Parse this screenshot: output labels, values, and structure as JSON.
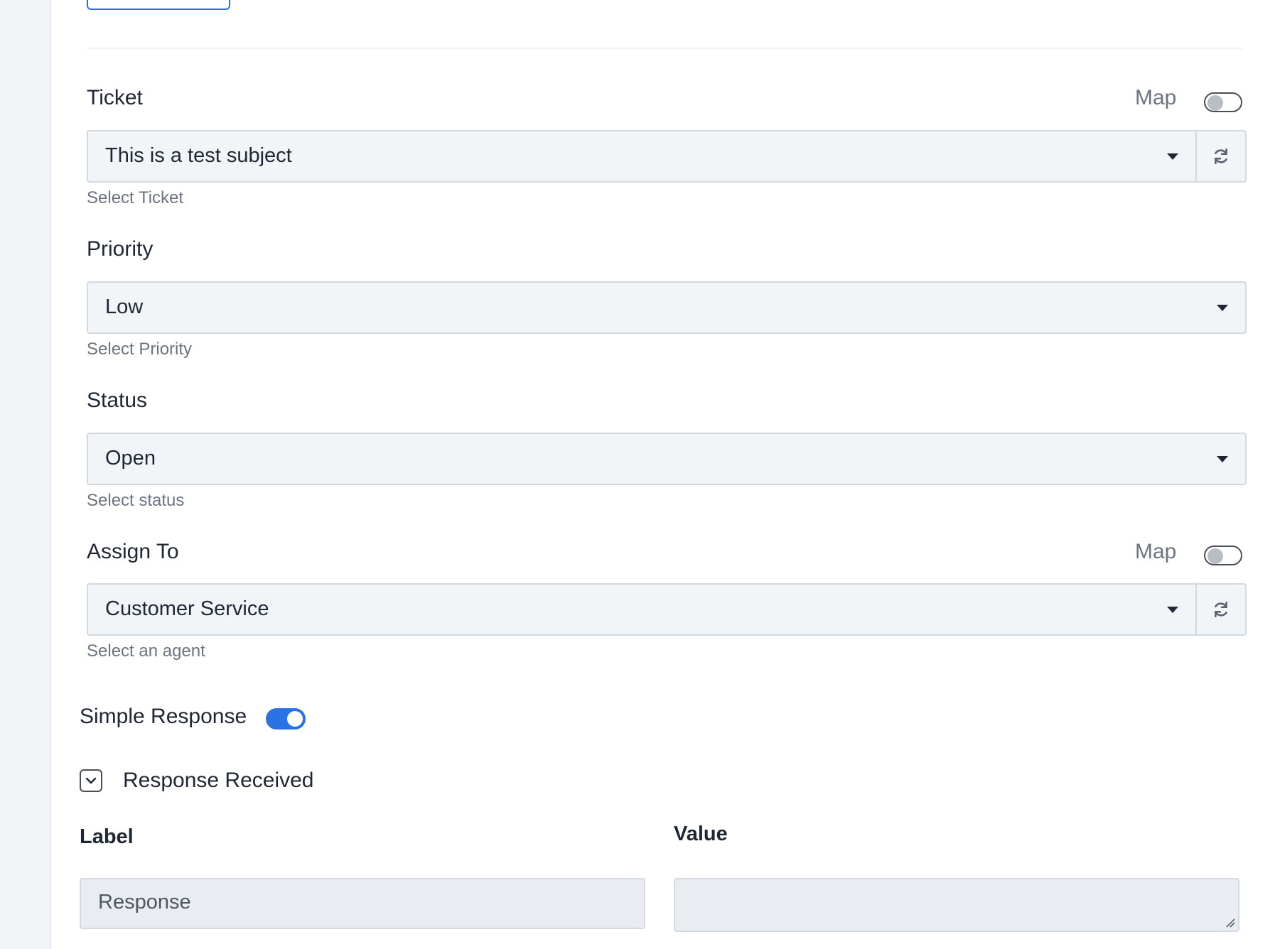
{
  "colors": {
    "accent": "#2b72e6",
    "field_bg": "#f2f5f8",
    "border": "#d4d9df",
    "text": "#1f2733",
    "muted": "#6b7480"
  },
  "fields": {
    "ticket": {
      "label": "Ticket",
      "map_label": "Map",
      "map_enabled": false,
      "value": "This is a test subject",
      "help": "Select Ticket",
      "icons": [
        "caret-down-icon",
        "refresh-icon"
      ]
    },
    "priority": {
      "label": "Priority",
      "value": "Low",
      "help": "Select Priority",
      "icons": [
        "caret-down-icon"
      ]
    },
    "status": {
      "label": "Status",
      "value": "Open",
      "help": "Select status",
      "icons": [
        "caret-down-icon"
      ]
    },
    "assign_to": {
      "label": "Assign To",
      "map_label": "Map",
      "map_enabled": false,
      "value": "Customer Service",
      "help": "Select an agent",
      "icons": [
        "caret-down-icon",
        "refresh-icon"
      ]
    }
  },
  "simple_response": {
    "label": "Simple Response",
    "enabled": true
  },
  "response_section": {
    "title": "Response Received",
    "expanded": true,
    "icon": "chevron-down-icon",
    "columns": {
      "label_header": "Label",
      "value_header": "Value"
    },
    "rows": [
      {
        "label": "Response",
        "value": ""
      }
    ]
  }
}
